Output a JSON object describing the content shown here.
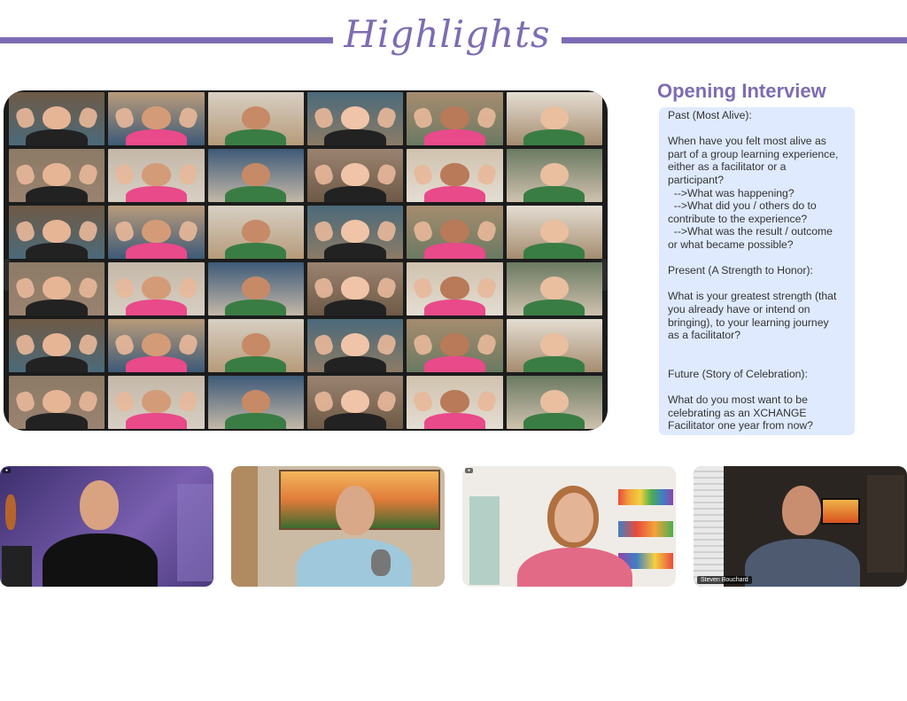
{
  "header": {
    "title": "Highlights"
  },
  "interview": {
    "title": "Opening Interview",
    "lines": [
      "Past (Most Alive):",
      "",
      "When have you felt most alive as",
      "part of a group learning experience,",
      "either as a facilitator or a",
      "participant?",
      "  -->What was happening?",
      "  -->What did you / others do to",
      "contribute to the experience?",
      "  -->What was the result / outcome",
      "or what became possible?",
      "",
      "Present (A Strength to Honor):",
      "",
      "What is your greatest strength (that",
      "you already have or intend on",
      "bringing), to your learning journey",
      "as a facilitator?",
      "",
      "",
      "Future (Story of Celebration):",
      "",
      "What do you most want to be",
      "celebrating as an XCHANGE",
      "Facilitator one year from now?"
    ]
  },
  "speakers": [
    {
      "name": "",
      "bg": "#5b4b8f"
    },
    {
      "name": "",
      "bg": "#c9b9a2"
    },
    {
      "name": "",
      "bg": "#e8e4de"
    },
    {
      "name": "Steven Bouchard",
      "bg": "#2b2521"
    }
  ],
  "colors": {
    "accent": "#7d6cb3",
    "panel": "#dfeaff"
  }
}
